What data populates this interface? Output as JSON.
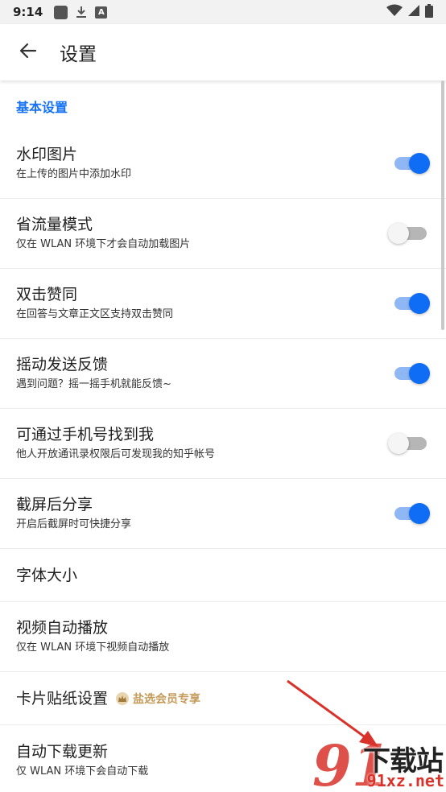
{
  "status_bar": {
    "time": "9:14",
    "icons": [
      "notification-square-icon",
      "download-icon",
      "text-a-icon"
    ],
    "right_icons": [
      "wifi-icon",
      "signal-icon",
      "battery-icon"
    ]
  },
  "app_bar": {
    "back_icon": "arrow-left-icon",
    "title": "设置"
  },
  "section": {
    "header": "基本设置"
  },
  "settings": {
    "watermark": {
      "title": "水印图片",
      "subtitle": "在上传的图片中添加水印",
      "enabled": true
    },
    "data_saver": {
      "title": "省流量模式",
      "subtitle": "仅在 WLAN 环境下才会自动加载图片",
      "enabled": false
    },
    "double_tap": {
      "title": "双击赞同",
      "subtitle": "在回答与文章正文区支持双击赞同",
      "enabled": true
    },
    "shake_feedback": {
      "title": "摇动发送反馈",
      "subtitle": "遇到问题？摇一摇手机就能反馈~",
      "enabled": true
    },
    "find_by_phone": {
      "title": "可通过手机号找到我",
      "subtitle": "他人开放通讯录权限后可发现我的知乎帐号",
      "enabled": false
    },
    "screenshot_share": {
      "title": "截屏后分享",
      "subtitle": "开启后截屏时可快捷分享",
      "enabled": true
    },
    "font_size": {
      "title": "字体大小"
    },
    "video_autoplay": {
      "title": "视频自动播放",
      "subtitle": "仅在 WLAN 环境下视频自动播放"
    },
    "card_sticker": {
      "title": "卡片贴纸设置",
      "badge": "盐选会员专享"
    },
    "auto_update": {
      "title": "自动下载更新",
      "subtitle": "仅 WLAN 环境下会自动下载"
    }
  },
  "watermark_overlay": {
    "logo_number": "91",
    "logo_text": "下载站",
    "domain": "91xz.net"
  },
  "colors": {
    "accent": "#1772f6",
    "toggle_on_knob": "#0f6cf5",
    "toggle_on_track": "#8fb7f4",
    "toggle_off_track": "#b6b6b6",
    "vip_gold": "#c39a57",
    "watermark_red": "#d9322b"
  }
}
